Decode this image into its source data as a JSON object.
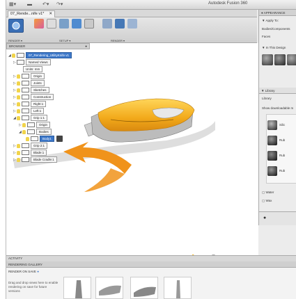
{
  "window_title": "Autodesk Fusion 360",
  "document_tab": "07_Rende...nife v1*",
  "toolbar": {
    "render_mode": "RENDER ▾",
    "setup": "SETUP ▾",
    "render": "RENDER ▾"
  },
  "browser": {
    "header": "BROWSER",
    "root": "07_Rendering_UtilityKnife v1",
    "items": [
      {
        "label": "Named Views"
      },
      {
        "label": "Units: mm"
      },
      {
        "label": "Origin"
      },
      {
        "label": "Joints"
      },
      {
        "label": "Sketches"
      },
      {
        "label": "Construction"
      },
      {
        "label": "Right:1"
      },
      {
        "label": "Left:1"
      },
      {
        "label": "Grip 1:1"
      },
      {
        "label": "Origin"
      },
      {
        "label": "Bodies"
      },
      {
        "label": "Body1"
      },
      {
        "label": "Grip 2:1"
      },
      {
        "label": "Blade:1"
      },
      {
        "label": "Blade Cradle:1"
      }
    ]
  },
  "appearance_panel": {
    "header": "APPEARANCE",
    "apply_to": "Apply To:",
    "option1": "Bodies/Components",
    "option2": "Faces",
    "in_this_design": "In This Design",
    "library_header": "Library",
    "library_label": "Library",
    "show_downloadable": "Show downloadable m",
    "lib_items": [
      "Silic",
      "Rub",
      "Rub",
      "Rub"
    ],
    "folders": [
      "Water",
      "Wax"
    ]
  },
  "status_bar": "ACTIVITY",
  "gallery": {
    "header": "RENDERING GALLERY",
    "render_on_save": "RENDER ON SAVE",
    "help_text": "Drag and drop views here to enable rendering on save for future versions"
  },
  "colors": {
    "accent": "#3d78c9",
    "arrow": "#f0931b",
    "handle": "#f2b318"
  }
}
